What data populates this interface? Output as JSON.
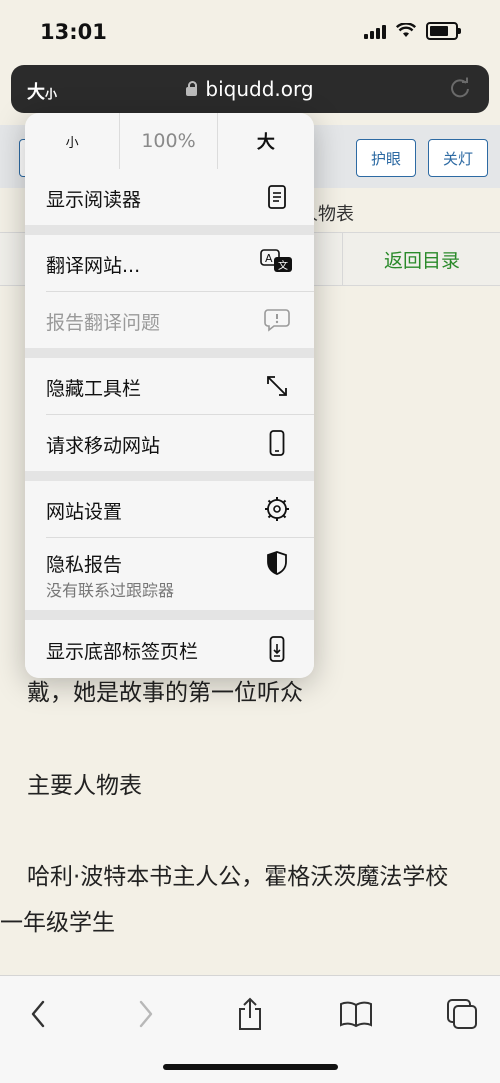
{
  "status": {
    "time": "13:01"
  },
  "address": {
    "aa_big": "大",
    "aa_small": "小",
    "domain": "biqudd.org"
  },
  "page": {
    "btn_eye": "护眼",
    "btn_light": "关灯",
    "breadcrumb_tail": "人物表",
    "return_link": "返回目录",
    "lines": [
      "戴，她是故事的第一位听众",
      "主要人物表",
      "哈利·波特本书主人公，霍格沃茨魔法学校",
      "一年级学生"
    ]
  },
  "menu": {
    "zoom_small": "小",
    "zoom_percent": "100%",
    "zoom_big": "大",
    "reader": "显示阅读器",
    "translate": "翻译网站...",
    "report_translation": "报告翻译问题",
    "hide_toolbar": "隐藏工具栏",
    "request_mobile": "请求移动网站",
    "site_settings": "网站设置",
    "privacy_report": "隐私报告",
    "privacy_sub": "没有联系过跟踪器",
    "bottom_tabbar": "显示底部标签页栏"
  }
}
